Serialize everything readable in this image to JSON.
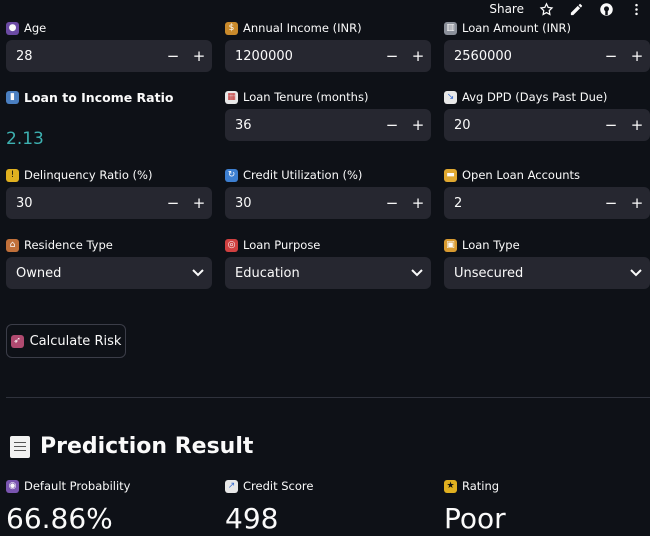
{
  "topbar": {
    "share_label": "Share",
    "icons": [
      "star-icon",
      "edit-icon",
      "github-icon",
      "more-icon"
    ]
  },
  "inputs": {
    "age": {
      "label": "Age",
      "value": "28",
      "icon": "person-icon"
    },
    "annual_income": {
      "label": "Annual Income (INR)",
      "value": "1200000",
      "icon": "money-bag-icon"
    },
    "loan_amount": {
      "label": "Loan Amount (INR)",
      "value": "2560000",
      "icon": "bank-icon"
    },
    "ratio": {
      "label": "Loan to Income Ratio",
      "value": "2.13",
      "icon": "bar-chart-icon"
    },
    "loan_tenure": {
      "label": "Loan Tenure (months)",
      "value": "36",
      "icon": "calendar-icon"
    },
    "avg_dpd": {
      "label": "Avg DPD (Days Past Due)",
      "value": "20",
      "icon": "chart-down-icon"
    },
    "delinquency": {
      "label": "Delinquency Ratio (%)",
      "value": "30",
      "icon": "warning-icon"
    },
    "credit_util": {
      "label": "Credit Utilization (%)",
      "value": "30",
      "icon": "refresh-icon"
    },
    "open_loans": {
      "label": "Open Loan Accounts",
      "value": "2",
      "icon": "folder-icon"
    },
    "residence": {
      "label": "Residence Type",
      "value": "Owned",
      "icon": "house-icon"
    },
    "purpose": {
      "label": "Loan Purpose",
      "value": "Education",
      "icon": "target-icon"
    },
    "loan_type": {
      "label": "Loan Type",
      "value": "Unsecured",
      "icon": "lock-icon"
    }
  },
  "stepper": {
    "minus": "−",
    "plus": "+"
  },
  "calculate_button": {
    "label": "Calculate Risk",
    "icon": "rocket-icon"
  },
  "result": {
    "title": "Prediction Result",
    "default_probability": {
      "label": "Default Probability",
      "value": "66.86%",
      "icon": "crystal-ball-icon"
    },
    "credit_score": {
      "label": "Credit Score",
      "value": "498",
      "icon": "chart-up-icon"
    },
    "rating": {
      "label": "Rating",
      "value": "Poor",
      "icon": "star-icon"
    }
  },
  "colors": {
    "background": "#0e1117",
    "input_bg": "#262730",
    "ratio_value": "#3db1b1"
  }
}
